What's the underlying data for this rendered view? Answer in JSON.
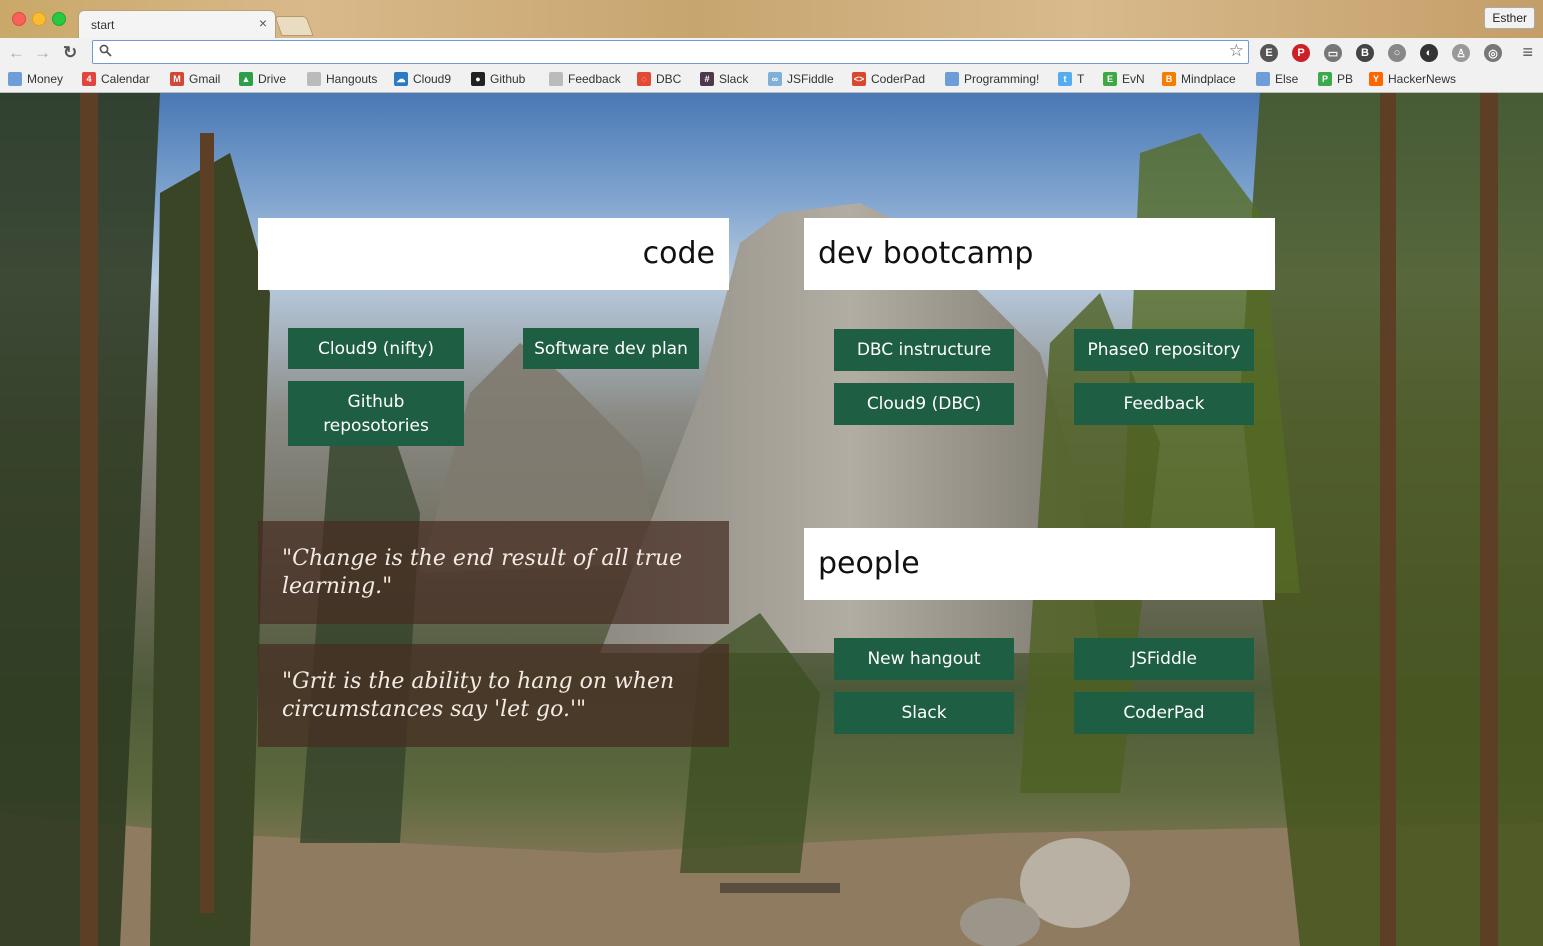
{
  "window": {
    "tab_title": "start",
    "tab_close": "×",
    "profile_name": "Esther"
  },
  "toolbar": {
    "back": "←",
    "forward": "→",
    "reload": "↻",
    "search_icon": "🔍",
    "omnibox_value": "",
    "star": "☆",
    "menu": "≡",
    "extensions": [
      {
        "name": "evernote-icon",
        "color": "#555555",
        "glyph": "E"
      },
      {
        "name": "pinterest-icon",
        "color": "#cb2027",
        "glyph": "P"
      },
      {
        "name": "cast-icon",
        "color": "#777777",
        "glyph": "▭"
      },
      {
        "name": "clipper-icon",
        "color": "#444444",
        "glyph": "B"
      },
      {
        "name": "search-ext-icon",
        "color": "#888888",
        "glyph": "○"
      },
      {
        "name": "shield-ext-icon",
        "color": "#333333",
        "glyph": "◐"
      },
      {
        "name": "person-ext-icon",
        "color": "#999999",
        "glyph": "♙"
      },
      {
        "name": "compass-ext-icon",
        "color": "#777777",
        "glyph": "◎"
      }
    ]
  },
  "bookmarks": [
    {
      "label": "Money",
      "icon": "folder-icon",
      "color": "#6d9ed8",
      "glyph": ""
    },
    {
      "label": "Calendar",
      "icon": "calendar-icon",
      "color": "#e0463b",
      "glyph": "4"
    },
    {
      "label": "Gmail",
      "icon": "gmail-icon",
      "color": "#d14836",
      "glyph": "M"
    },
    {
      "label": "Drive",
      "icon": "drive-icon",
      "color": "#2d9f48",
      "glyph": "▲"
    },
    {
      "label": "Hangouts",
      "icon": "page-icon",
      "color": "#bbbbbb",
      "glyph": ""
    },
    {
      "label": "Cloud9",
      "icon": "cloud9-icon",
      "color": "#2a7bc4",
      "glyph": "☁"
    },
    {
      "label": "Github",
      "icon": "github-icon",
      "color": "#222222",
      "glyph": "●"
    },
    {
      "label": "Feedback",
      "icon": "page-icon",
      "color": "#bbbbbb",
      "glyph": ""
    },
    {
      "label": "DBC",
      "icon": "dbc-icon",
      "color": "#e24a34",
      "glyph": "◌"
    },
    {
      "label": "Slack",
      "icon": "slack-icon",
      "color": "#4d394b",
      "glyph": "#"
    },
    {
      "label": "JSFiddle",
      "icon": "jsfiddle-icon",
      "color": "#7fb0d8",
      "glyph": "∞"
    },
    {
      "label": "CoderPad",
      "icon": "coderpad-icon",
      "color": "#d9472f",
      "glyph": "<>"
    },
    {
      "label": "Programming!",
      "icon": "folder-icon",
      "color": "#6d9ed8",
      "glyph": ""
    },
    {
      "label": "T",
      "icon": "twitter-icon",
      "color": "#55acee",
      "glyph": "t"
    },
    {
      "label": "EvN",
      "icon": "evernote-icon",
      "color": "#3fa845",
      "glyph": "E"
    },
    {
      "label": "Mindplace",
      "icon": "blogger-icon",
      "color": "#f57d00",
      "glyph": "B"
    },
    {
      "label": "Else",
      "icon": "folder-icon",
      "color": "#6d9ed8",
      "glyph": ""
    },
    {
      "label": "PB",
      "icon": "pb-icon",
      "color": "#3caa4a",
      "glyph": "P"
    },
    {
      "label": "HackerNews",
      "icon": "hackernews-icon",
      "color": "#ff6600",
      "glyph": "Y"
    }
  ],
  "sections": {
    "code": "code",
    "dev_bootcamp": "dev bootcamp",
    "people": "people"
  },
  "links": {
    "code": [
      "Cloud9 (nifty)",
      "Software dev plan",
      "Github reposotories"
    ],
    "dev_bootcamp": [
      "DBC instructure",
      "Phase0 repository",
      "Cloud9 (DBC)",
      "Feedback"
    ],
    "people": [
      "New hangout",
      "JSFiddle",
      "Slack",
      "CoderPad"
    ]
  },
  "quotes": [
    "\"Change is the end result of all true learning.\"",
    "\"Grit is the ability to hang on when circumstances say 'let go.'\""
  ]
}
